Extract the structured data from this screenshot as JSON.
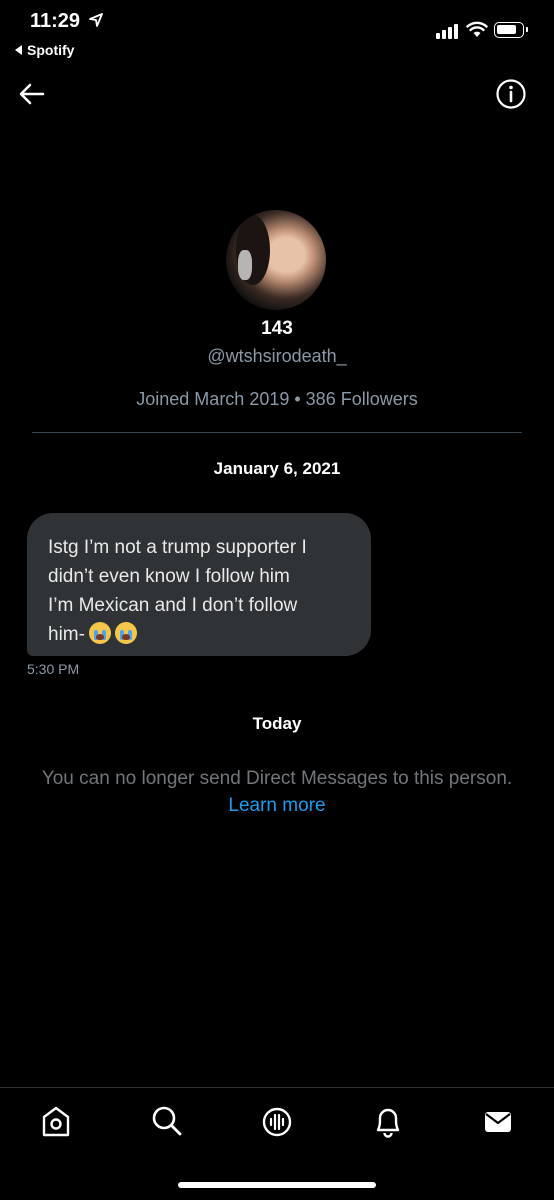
{
  "status_bar": {
    "time": "11:29",
    "back_app": "Spotify"
  },
  "profile": {
    "name": "143",
    "handle": "@wtshsirodeath_",
    "joined": "Joined March 2019 • 386 Followers"
  },
  "conversation": {
    "date_header": "January 6, 2021",
    "message": {
      "line1": "Istg I’m not a trump supporter I",
      "line2": "didn’t even know I follow him",
      "line3": "I’m Mexican and I don’t follow",
      "line4": "him-",
      "emojis": [
        "loudly-crying-face",
        "loudly-crying-face"
      ],
      "time": "5:30 PM"
    },
    "today_header": "Today",
    "notice": "You can no longer send Direct Messages to this person.",
    "learn_more": "Learn more"
  },
  "tabs": [
    "home-icon",
    "search-icon",
    "spaces-icon",
    "notifications-icon",
    "messages-icon"
  ],
  "colors": {
    "background": "#000000",
    "bubble": "#2f3336",
    "secondary": "#8b98a5",
    "link": "#1d9bf0"
  }
}
